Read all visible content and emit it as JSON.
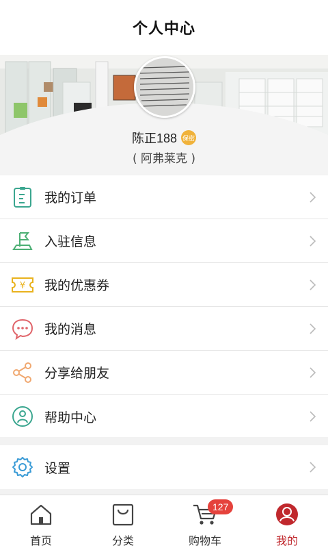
{
  "header": {
    "title": "个人中心"
  },
  "profile": {
    "name": "陈正188",
    "badge": "保密",
    "subtitle": "( 阿弗莱克 )"
  },
  "menu": {
    "items": [
      {
        "label": "我的订单",
        "icon": "order-icon"
      },
      {
        "label": "入驻信息",
        "icon": "flag-icon"
      },
      {
        "label": "我的优惠券",
        "icon": "coupon-icon"
      },
      {
        "label": "我的消息",
        "icon": "message-icon"
      },
      {
        "label": "分享给朋友",
        "icon": "share-icon"
      },
      {
        "label": "帮助中心",
        "icon": "help-icon"
      }
    ],
    "settings": {
      "label": "设置",
      "icon": "gear-icon"
    }
  },
  "tabbar": {
    "items": [
      {
        "label": "首页",
        "icon": "home-icon"
      },
      {
        "label": "分类",
        "icon": "bag-icon"
      },
      {
        "label": "购物车",
        "icon": "cart-icon",
        "badge": "127"
      },
      {
        "label": "我的",
        "icon": "user-icon",
        "active": true
      }
    ]
  },
  "colors": {
    "accent": "#c0282d",
    "badge": "#e5423c",
    "teal": "#3aa68f",
    "green": "#4caf74",
    "yellow": "#e9b21d",
    "pink": "#e0646a",
    "orange": "#f0a870",
    "blue": "#3a9bd6"
  }
}
